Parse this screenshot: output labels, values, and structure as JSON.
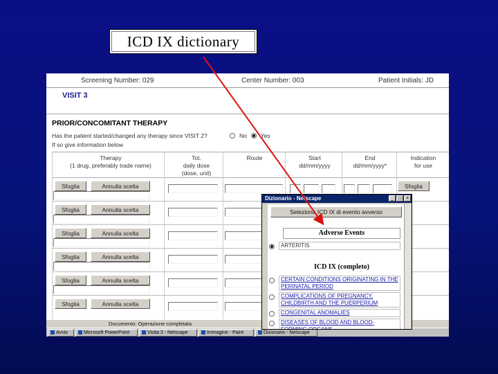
{
  "slide": {
    "title": "ICD IX dictionary"
  },
  "page": {
    "screening": "Screening Number: 029",
    "center": "Center Number: 003",
    "patient": "Patient Initials: JD",
    "visit": "VISIT 3",
    "section": "PRIOR/CONCOMITANT THERAPY",
    "question": "Has the patient started/changed any therapy since VISIT 2?",
    "options": [
      "No",
      "Yes"
    ],
    "hint": "If so give information below",
    "columns": [
      "Therapy\n(1 drug, preferably trade name)",
      "Tot.\ndaily dose\n(dose, unit)",
      "Route",
      "Start\ndd/mm/yyyy",
      "End\ndd/mm/yyyy*",
      "Indication\nfor use"
    ],
    "browse_label": "Sfoglia",
    "clear_label": "Annulla scelta",
    "status": "Documento: Operazione completata"
  },
  "taskbar": {
    "items": [
      "Avvio",
      "Microsoft PowerPoint",
      "Visita 3 - Netscape",
      "Immagine - Paint",
      "Dizionario - Netscape"
    ]
  },
  "popup": {
    "title": "Dizionario - Netscape",
    "select_label": "Seleziona ICD IX di evento avverso",
    "ae_header": "Adverse Events",
    "selected_item": "ARTERITIS",
    "icd_header": "ICD IX (completo)",
    "items": [
      "CERTAIN CONDITIONS ORIGINATING IN THE PERINATAL PERIOD",
      "COMPLICATIONS OF PREGNANCY, CHILDBIRTH AND THE PUERPERIUM",
      "CONGENITAL ANOMALIES",
      "DISEASES OF BLOOD AND BLOOD-FORMING ORGANS"
    ]
  },
  "colors": {
    "background": "#0b0f86",
    "arrow": "#e01010",
    "link": "#1a1aaa",
    "titlebar": "#0a246a"
  }
}
